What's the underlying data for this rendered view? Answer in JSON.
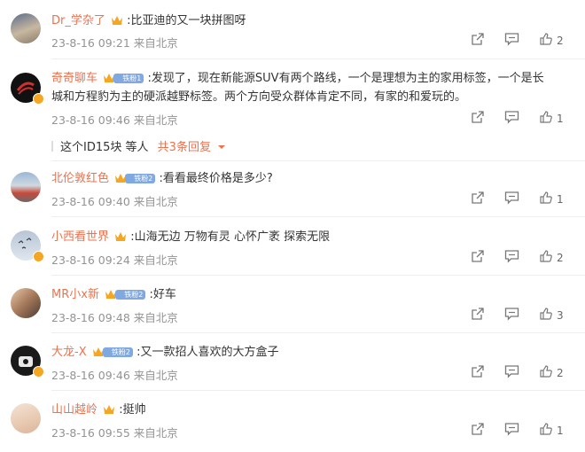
{
  "comments": [
    {
      "username": "Dr_学杂了",
      "fan_level": "",
      "text": ":比亚迪的又一块拼图呀",
      "time": "23-8-16 09:21",
      "location": "来自北京",
      "likes": "2"
    },
    {
      "username": "奇奇聊车",
      "fan_level": "铁粉1",
      "text_line1": ":发现了，现在新能源SUV有两个路线，一个是理想为主的家用标签，一个是长",
      "text_line2": "城和方程豹为主的硬派越野标签。两个方向受众群体肯定不同，有家的和爱玩的。",
      "time": "23-8-16 09:46",
      "location": "来自北京",
      "likes": "1"
    },
    {
      "username": "北伦敦红色",
      "fan_level": "铁粉2",
      "text": ":看看最终价格是多少?",
      "time": "23-8-16 09:40",
      "location": "来自北京",
      "likes": "1"
    },
    {
      "username": "小西看世界",
      "fan_level": "",
      "text": ":山海无边 万物有灵 心怀广袤 探索无限",
      "time": "23-8-16 09:24",
      "location": "来自北京",
      "likes": "2"
    },
    {
      "username": "MR小x新",
      "fan_level": "铁粉2",
      "text": ":好车",
      "time": "23-8-16 09:48",
      "location": "来自北京",
      "likes": "3"
    },
    {
      "username": "大龙-X",
      "fan_level": "铁粉2",
      "text": ":又一款招人喜欢的大方盒子",
      "time": "23-8-16 09:46",
      "location": "来自北京",
      "likes": "2"
    },
    {
      "username": "山山越岭",
      "fan_level": "",
      "text": ":挺帅",
      "time": "23-8-16 09:55",
      "location": "来自北京",
      "likes": "1"
    }
  ],
  "reply_summary": {
    "users": "这个ID15块",
    "suffix": " 等人",
    "count": "共3条回复"
  },
  "icons": {
    "share": "share-icon",
    "comment": "comment-icon",
    "like": "thumbs-up-icon",
    "crown": "crown-badge-icon",
    "verified": "verified-v-icon"
  },
  "colors": {
    "username": "#eb7350",
    "text": "#333333",
    "meta": "#939393",
    "fan_badge": "#7fa9e0",
    "crown": "#f5a623"
  }
}
